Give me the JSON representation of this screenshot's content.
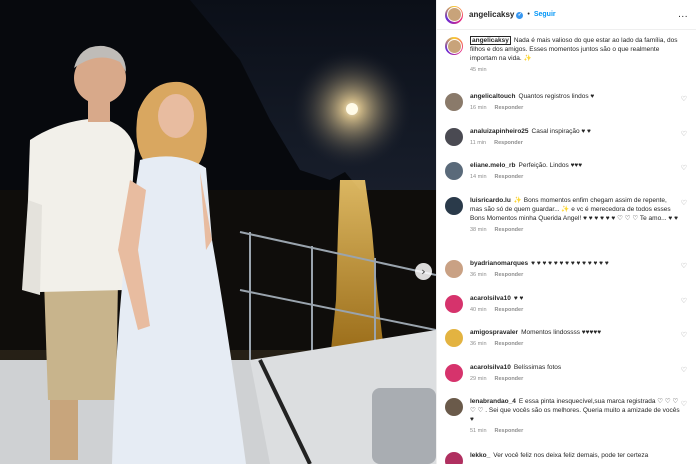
{
  "post_header": {
    "username": "angelicaksy",
    "follow_label": "Seguir",
    "more_label": "..."
  },
  "caption": {
    "username": "angelicaksy",
    "text": "Nada é mais valioso do que estar ao lado da família, dos filhos e dos amigos. Esses momentos juntos são o que realmente importam na vida. ✨",
    "time": "45 min"
  },
  "comments": [
    {
      "username": "angelicaltouch",
      "text": "Quantos registros lindos ♥",
      "time": "16 min",
      "reply": "Responder",
      "avatar_color": "#8a7a6a"
    },
    {
      "username": "analuizapinheiro25",
      "text": "Casal inspiração ♥ ♥",
      "time": "11 min",
      "reply": "Responder",
      "avatar_color": "#4a4a52"
    },
    {
      "username": "eliane.melo_rb",
      "text": "Perfeição. Lindos ♥♥♥",
      "time": "14 min",
      "reply": "Responder",
      "avatar_color": "#5a6a7a"
    },
    {
      "username": "luisricardo.lu",
      "text": "✨ Bons momentos enfim chegam assim de repente, mas são só de quem guardar... ✨ e vc é merecedora de todos esses Bons Momentos minha Querida Angel! ♥ ♥ ♥ ♥ ♥ ♥ ♡ ♡ ♡ Te amo... ♥ ♥",
      "time": "38 min",
      "reply": "Responder",
      "avatar_color": "#2a3a4a"
    },
    {
      "username": "byadrianomarques",
      "text": "♥ ♥ ♥ ♥ ♥ ♥ ♥ ♥ ♥ ♥ ♥ ♥ ♥ ♥",
      "time": "36 min",
      "reply": "Responder",
      "avatar_color": "#c9a184"
    },
    {
      "username": "acarolsilva10",
      "text": "♥ ♥",
      "time": "40 min",
      "reply": "Responder",
      "avatar_color": "#d6336c"
    },
    {
      "username": "amigospravaler",
      "text": "Momentos lindossss ♥♥♥♥♥",
      "time": "36 min",
      "reply": "Responder",
      "avatar_color": "#e3b341"
    },
    {
      "username": "acarolsilva10",
      "text": "Belíssimas fotos",
      "time": "29 min",
      "reply": "Responder",
      "avatar_color": "#d6336c"
    },
    {
      "username": "lenabrandao_4",
      "text": "E essa pinta inesquecível,sua marca registrada ♡ ♡ ♡ ♡ ♡ . Sei que vocês são os melhores. Queria muito a amizade de vocês ♥",
      "time": "51 min",
      "reply": "Responder",
      "avatar_color": "#6a5a4a"
    }
  ],
  "partial_comment": {
    "username": "lekko_",
    "text": "Ver você feliz nos deixa feliz demais, pode ter certeza",
    "avatar_color": "#b03060"
  },
  "icons": {
    "heart": "heart-icon",
    "next": "chevron-right-icon",
    "verified": "verified-badge-icon"
  },
  "glyphs": {
    "heart": "♡",
    "next": "›",
    "verified": "✓"
  }
}
